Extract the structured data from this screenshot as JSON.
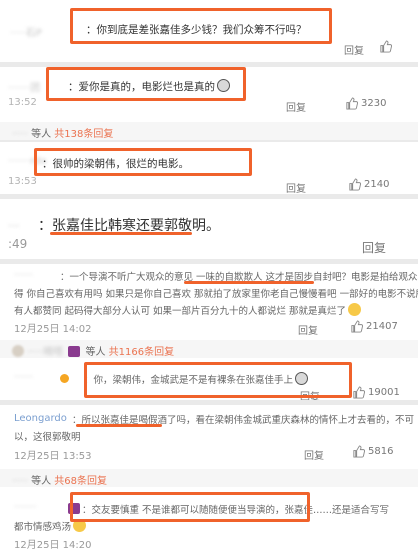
{
  "comments": [
    {
      "user": "·····石P",
      "text": "：你到底是差张嘉佳多少钱？我们众筹不行吗？",
      "reply": "回复",
      "likes": ""
    },
    {
      "user": "·······团",
      "text": "：爱你是真的，电影烂也是真的",
      "time": "13:52",
      "reply": "回复",
      "likes": "3230"
    },
    {
      "user": "·······rdo",
      "text": "：很帅的梁朝伟，很烂的电影。",
      "time": "13:53",
      "reply": "回复",
      "likes": "2140"
    },
    {
      "user": "···",
      "text": "：张嘉佳比韩寒还要郭敬明。",
      "time": ":49",
      "reply": "回复"
    },
    {
      "user": "······",
      "line1": "：一个导演不听广大观众的意见 一味的自欺欺人 这才是固步自封吧？电影是拍给观众看",
      "line2": "得 你自己喜欢有用吗 如果只是你自己喜欢 那就拍了放家里你老自己慢慢看吧 一部好的电影不说所",
      "line3": "有人都赞同 起码得大部分人认可 如果一部片百分九十的人都说烂 那就是真烂了",
      "time": "12月25日 14:02",
      "reply": "回复",
      "likes": "21407"
    },
    {
      "user": "······",
      "text": "：你，梁朝伟，金城武是不是有裸条在张嘉佳手上",
      "reply": "回复",
      "likes": "19001"
    },
    {
      "user": "Leongardo",
      "line1": "：所以张嘉佳是喝假酒了吗，看在梁朝伟金城武重庆森林的情怀上才去看的，不可",
      "line2": "以，这很郭敬明",
      "time": "12月25日 13:53",
      "reply": "回复",
      "likes": "5816"
    },
    {
      "user": "·······",
      "line1": "：交友要慎重 不是谁都可以随随便便当导演的，张嘉佳……还是适合写写",
      "line2": "都市情感鸡汤",
      "time": "12月25日 14:20"
    }
  ],
  "subreplies": [
    {
      "user": "·····",
      "text": "等人",
      "count": "共138条回复"
    },
    {
      "user": "·····嘀嗒",
      "text": "等人",
      "count": "共1166条回复"
    },
    {
      "user": "·····",
      "text": "等人",
      "count": "共68条回复"
    }
  ],
  "colors": {
    "highlight": "#f0622b",
    "link": "#eb7350",
    "separator": "#eaeaea"
  },
  "icons": {
    "like": "thumbs-up-icon",
    "emoji": "emoji-icon"
  }
}
